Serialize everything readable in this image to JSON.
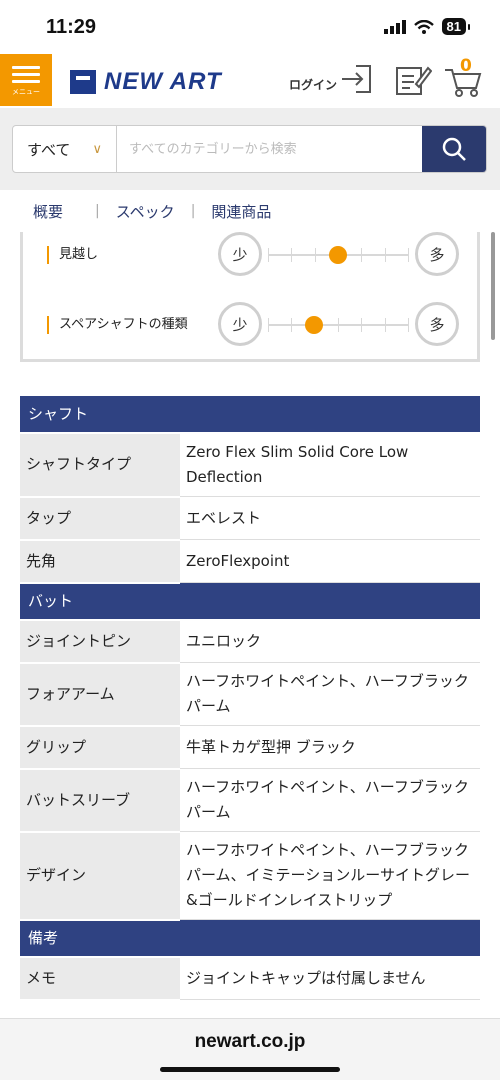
{
  "status": {
    "time": "11:29",
    "battery": "81"
  },
  "header": {
    "menu_label": "メニュー",
    "logo_text": "NEW ART",
    "login_label": "ログイン",
    "cart_count": "0"
  },
  "search": {
    "scope": "すべて",
    "placeholder": "すべてのカテゴリーから検索"
  },
  "tabs": [
    "概要",
    "スペック",
    "関連商品"
  ],
  "levels": [
    {
      "label": "見越し",
      "min_label": "少",
      "max_label": "多",
      "value": 0.5
    },
    {
      "label": "スペアシャフトの種類",
      "min_label": "少",
      "max_label": "多",
      "value": 0.33
    }
  ],
  "spec": {
    "shaft_title": "シャフト",
    "shaft_rows": [
      {
        "key": "シャフトタイプ",
        "value": "Zero Flex Slim Solid Core Low Deflection"
      },
      {
        "key": "タップ",
        "value": "エベレスト"
      },
      {
        "key": "先角",
        "value": "ZeroFlexpoint"
      }
    ],
    "butt_title": "バット",
    "butt_rows": [
      {
        "key": "ジョイントピン",
        "value": "ユニロック"
      },
      {
        "key": "フォアアーム",
        "value": "ハーフホワイトペイント、ハーフブラックパーム"
      },
      {
        "key": "グリップ",
        "value": "牛革トカゲ型押 ブラック"
      },
      {
        "key": "バットスリーブ",
        "value": "ハーフホワイトペイント、ハーフブラックパーム"
      },
      {
        "key": "デザイン",
        "value": "ハーフホワイトペイント、ハーフブラックパーム、イミテーションルーサイトグレー&ゴールドインレイストリップ"
      }
    ],
    "notes_title": "備考",
    "notes_rows": [
      {
        "key": "メモ",
        "value": "ジョイントキャップは付属しません"
      }
    ]
  },
  "footer": {
    "domain": "newart.co.jp"
  },
  "colors": {
    "accent": "#f39800",
    "navy": "#2f4282"
  }
}
